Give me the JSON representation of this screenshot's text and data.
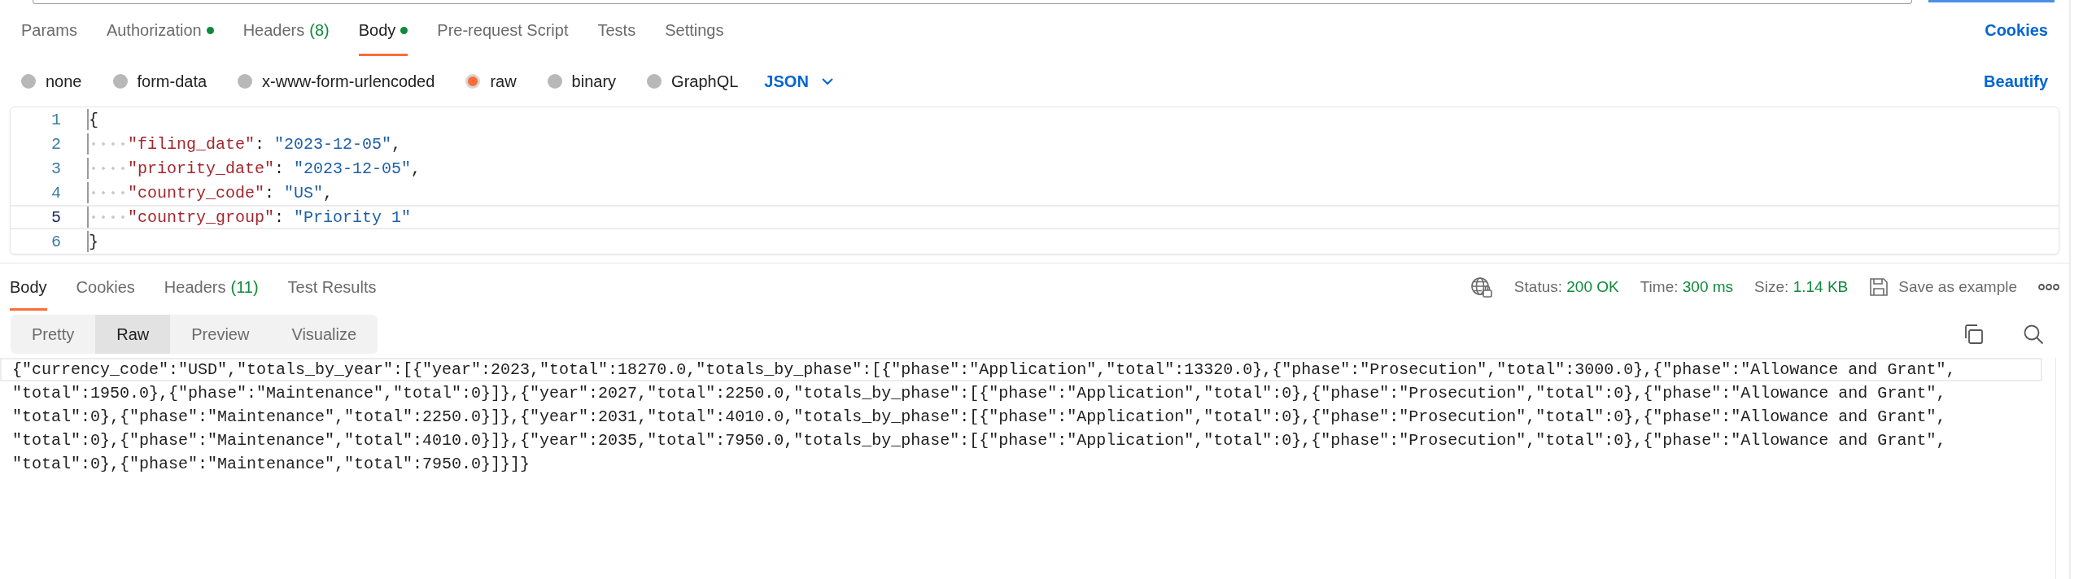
{
  "request_tabs": [
    {
      "label": "Params",
      "selected": false,
      "indicator": false
    },
    {
      "label": "Authorization",
      "selected": false,
      "indicator": true
    },
    {
      "label": "Headers",
      "count": "(8)",
      "selected": false,
      "indicator": false
    },
    {
      "label": "Body",
      "selected": true,
      "indicator": true
    },
    {
      "label": "Pre-request Script",
      "selected": false,
      "indicator": false
    },
    {
      "label": "Tests",
      "selected": false,
      "indicator": false
    },
    {
      "label": "Settings",
      "selected": false,
      "indicator": false
    }
  ],
  "cookies_link": "Cookies",
  "body_types": [
    {
      "label": "none",
      "selected": false
    },
    {
      "label": "form-data",
      "selected": false
    },
    {
      "label": "x-www-form-urlencoded",
      "selected": false
    },
    {
      "label": "raw",
      "selected": true
    },
    {
      "label": "binary",
      "selected": false
    },
    {
      "label": "GraphQL",
      "selected": false
    }
  ],
  "format_dropdown": "JSON",
  "beautify_link": "Beautify",
  "editor": {
    "lines": [
      {
        "number": "1",
        "active": false,
        "tokens": [
          {
            "kind": "punct",
            "text": "{"
          }
        ]
      },
      {
        "number": "2",
        "active": false,
        "indented": true,
        "tokens": [
          {
            "kind": "key",
            "text": "\"filing_date\""
          },
          {
            "kind": "punct",
            "text": ": "
          },
          {
            "kind": "string",
            "text": "\"2023-12-05\""
          },
          {
            "kind": "punct",
            "text": ","
          }
        ]
      },
      {
        "number": "3",
        "active": false,
        "indented": true,
        "tokens": [
          {
            "kind": "key",
            "text": "\"priority_date\""
          },
          {
            "kind": "punct",
            "text": ": "
          },
          {
            "kind": "string",
            "text": "\"2023-12-05\""
          },
          {
            "kind": "punct",
            "text": ","
          }
        ]
      },
      {
        "number": "4",
        "active": false,
        "indented": true,
        "tokens": [
          {
            "kind": "key",
            "text": "\"country_code\""
          },
          {
            "kind": "punct",
            "text": ": "
          },
          {
            "kind": "string",
            "text": "\"US\""
          },
          {
            "kind": "punct",
            "text": ","
          }
        ]
      },
      {
        "number": "5",
        "active": true,
        "indented": true,
        "tokens": [
          {
            "kind": "key",
            "text": "\"country_group\""
          },
          {
            "kind": "punct",
            "text": ": "
          },
          {
            "kind": "string",
            "text": "\"Priority 1\""
          }
        ]
      },
      {
        "number": "6",
        "active": false,
        "tokens": [
          {
            "kind": "punct",
            "text": "}"
          }
        ]
      }
    ]
  },
  "response_tabs": [
    {
      "label": "Body",
      "selected": true
    },
    {
      "label": "Cookies",
      "selected": false
    },
    {
      "label": "Headers",
      "count": "(11)",
      "selected": false
    },
    {
      "label": "Test Results",
      "selected": false
    }
  ],
  "status": [
    {
      "label": "Status:",
      "value": "200 OK"
    },
    {
      "label": "Time:",
      "value": "300 ms"
    },
    {
      "label": "Size:",
      "value": "1.14 KB"
    }
  ],
  "save_button": "Save as example",
  "view_modes": [
    {
      "label": "Pretty",
      "selected": false
    },
    {
      "label": "Raw",
      "selected": true
    },
    {
      "label": "Preview",
      "selected": false
    },
    {
      "label": "Visualize",
      "selected": false
    }
  ],
  "response_body": {
    "lines": [
      {
        "active": true,
        "text": "{\"currency_code\":\"USD\",\"totals_by_year\":[{\"year\":2023,\"total\":18270.0,\"totals_by_phase\":[{\"phase\":\"Application\",\"total\":13320.0},{\"phase\":\"Prosecution\",\"total\":3000.0},{\"phase\":\"Allowance and Grant\","
      },
      {
        "active": false,
        "text": "\"total\":1950.0},{\"phase\":\"Maintenance\",\"total\":0}]},{\"year\":2027,\"total\":2250.0,\"totals_by_phase\":[{\"phase\":\"Application\",\"total\":0},{\"phase\":\"Prosecution\",\"total\":0},{\"phase\":\"Allowance and Grant\","
      },
      {
        "active": false,
        "text": "\"total\":0},{\"phase\":\"Maintenance\",\"total\":2250.0}]},{\"year\":2031,\"total\":4010.0,\"totals_by_phase\":[{\"phase\":\"Application\",\"total\":0},{\"phase\":\"Prosecution\",\"total\":0},{\"phase\":\"Allowance and Grant\","
      },
      {
        "active": false,
        "text": "\"total\":0},{\"phase\":\"Maintenance\",\"total\":4010.0}]},{\"year\":2035,\"total\":7950.0,\"totals_by_phase\":[{\"phase\":\"Application\",\"total\":0},{\"phase\":\"Prosecution\",\"total\":0},{\"phase\":\"Allowance and Grant\","
      },
      {
        "active": false,
        "text": "\"total\":0},{\"phase\":\"Maintenance\",\"total\":7950.0}]}]}"
      }
    ]
  }
}
